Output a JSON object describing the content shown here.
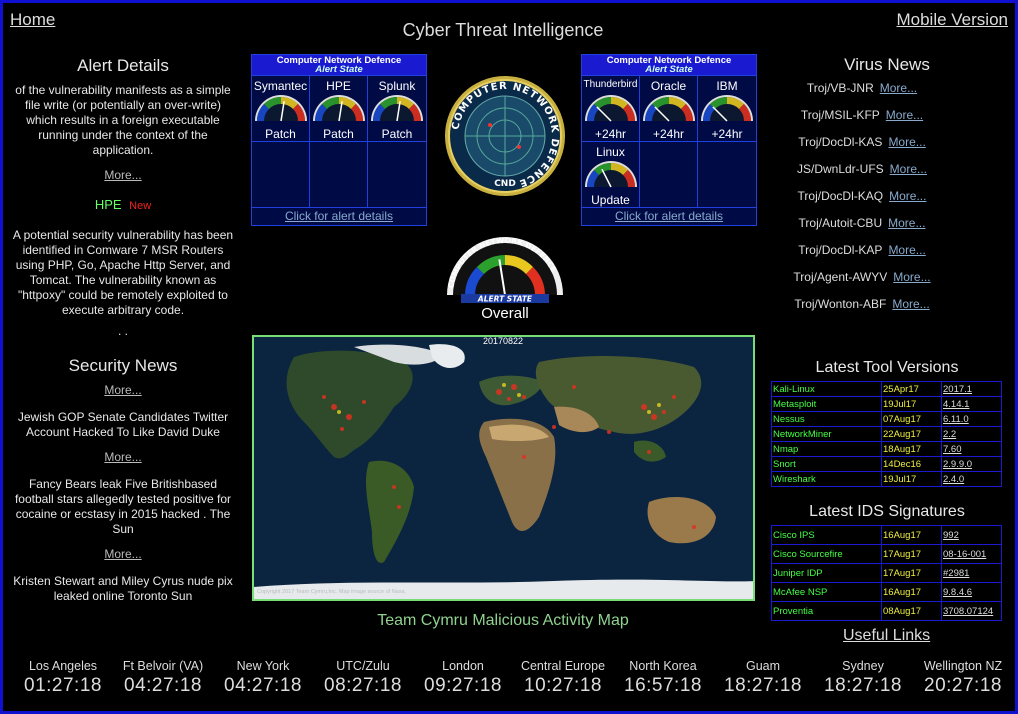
{
  "header": {
    "home_label": "Home",
    "title": "Cyber Threat Intelligence",
    "mobile_label": "Mobile Version"
  },
  "alert_details": {
    "heading": "Alert Details",
    "text1": "of the vulnerability manifests as a simple file write (or potentially an over-write) which results in a foreign executable running under the context of the application.",
    "more1": "More...",
    "vendor": "HPE",
    "new_label": "New",
    "text2": "A potential security vulnerability has been identified in Comware 7 MSR Routers using PHP, Go, Apache Http Server, and Tomcat. The vulnerability known as \"httpoxy\" could be remotely exploited to execute arbitrary code.",
    "dots": ". ."
  },
  "security_news": {
    "heading": "Security News",
    "more_label": "More...",
    "items": [
      "Jewish GOP Senate Candidates Twitter Account Hacked To Like David Duke",
      "Fancy Bears leak Five Britishbased football stars allegedly tested positive for cocaine or ecstasy in 2015 hacked . The Sun",
      "Kristen Stewart and Miley Cyrus nude pix leaked online Toronto Sun"
    ]
  },
  "panel_left": {
    "head_title": "Computer Network Defence",
    "head_sub": "Alert State",
    "vendors": [
      {
        "name": "Symantec",
        "status": "Patch",
        "level": 0.55
      },
      {
        "name": "HPE",
        "status": "Patch",
        "level": 0.55
      },
      {
        "name": "Splunk",
        "status": "Patch",
        "level": 0.55
      }
    ],
    "footer_link": "Click for alert details"
  },
  "panel_right": {
    "head_title": "Computer Network Defence",
    "head_sub": "Alert State",
    "vendors": [
      {
        "name": "Thunderbird",
        "status": "+24hr",
        "level": 0.25
      },
      {
        "name": "Oracle",
        "status": "+24hr",
        "level": 0.25
      },
      {
        "name": "IBM",
        "status": "+24hr",
        "level": 0.25
      },
      {
        "name": "Linux",
        "status": "Update",
        "level": 0.35
      }
    ],
    "footer_link": "Click for alert details"
  },
  "emblem": {
    "ring_text": "COMPUTER NETWORK DEFENCE",
    "center_text": "CND"
  },
  "overall": {
    "ring_text": "COMPUTER NETWORK DEFENCE",
    "banner": "ALERT STATE",
    "label": "Overall",
    "level": 0.45
  },
  "map": {
    "date": "20170822",
    "copyright": "Copyright 2017 Team Cymru,Inc. Map image source of Nasa.",
    "caption": "Team Cymru Malicious Activity Map"
  },
  "virus_news": {
    "heading": "Virus News",
    "more_label": "More...",
    "items": [
      "Troj/VB-JNR",
      "Troj/MSIL-KFP",
      "Troj/DocDl-KAS",
      "JS/DwnLdr-UFS",
      "Troj/DocDl-KAQ",
      "Troj/Autoit-CBU",
      "Troj/DocDl-KAP",
      "Troj/Agent-AWYV",
      "Troj/Wonton-ABF"
    ]
  },
  "tool_versions": {
    "heading": "Latest Tool Versions",
    "rows": [
      {
        "name": "Kali-Linux",
        "date": "25Apr17",
        "version": "2017.1"
      },
      {
        "name": "Metasploit",
        "date": "19Jul17",
        "version": "4.14.1"
      },
      {
        "name": "Nessus",
        "date": "07Aug17",
        "version": "6.11.0"
      },
      {
        "name": "NetworkMiner",
        "date": "22Aug17",
        "version": "2.2"
      },
      {
        "name": "Nmap",
        "date": "18Aug17",
        "version": "7.60"
      },
      {
        "name": "Snort",
        "date": "14Dec16",
        "version": "2.9.9.0"
      },
      {
        "name": "Wireshark",
        "date": "19Jul17",
        "version": "2.4.0"
      }
    ]
  },
  "ids_signatures": {
    "heading": "Latest IDS Signatures",
    "rows": [
      {
        "name": "Cisco IPS",
        "date": "16Aug17",
        "version": "992"
      },
      {
        "name": "Cisco Sourcefire",
        "date": "17Aug17",
        "version": "08-16-001"
      },
      {
        "name": "Juniper IDP",
        "date": "17Aug17",
        "version": "#2981"
      },
      {
        "name": "McAfee NSP",
        "date": "16Aug17",
        "version": "9.8.4.6"
      },
      {
        "name": "Proventia",
        "date": "08Aug17",
        "version": "3708.07124"
      }
    ]
  },
  "useful_links": "Useful Links",
  "clocks": [
    {
      "city": "Los Angeles",
      "time": "01:27:18"
    },
    {
      "city": "Ft Belvoir (VA)",
      "time": "04:27:18"
    },
    {
      "city": "New York",
      "time": "04:27:18"
    },
    {
      "city": "UTC/Zulu",
      "time": "08:27:18"
    },
    {
      "city": "London",
      "time": "09:27:18"
    },
    {
      "city": "Central Europe",
      "time": "10:27:18"
    },
    {
      "city": "North Korea",
      "time": "16:57:18"
    },
    {
      "city": "Guam",
      "time": "18:27:18"
    },
    {
      "city": "Sydney",
      "time": "18:27:18"
    },
    {
      "city": "Wellington NZ",
      "time": "20:27:18"
    }
  ]
}
